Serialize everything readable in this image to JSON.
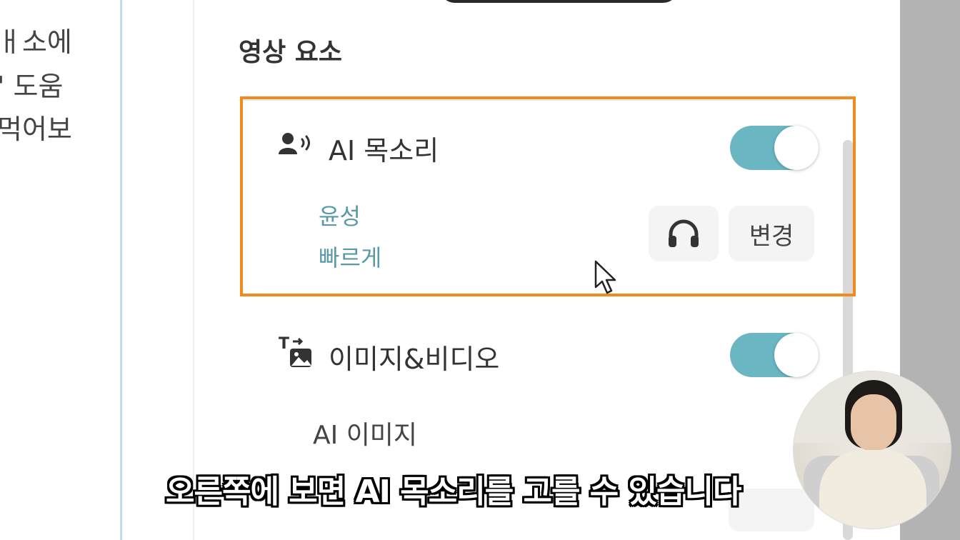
{
  "left_fragments": [
    "ㅐ소에",
    "' 도움",
    "먹어보"
  ],
  "section": {
    "title": "영상 요소"
  },
  "ai_voice": {
    "title": "AI 목소리",
    "icon": "voice-person-icon",
    "toggle_on": true,
    "voice_name": "윤성",
    "voice_speed": "빠르게",
    "listen_icon": "headphones-icon",
    "change_label": "변경"
  },
  "image_video": {
    "title": "이미지&비디오",
    "icon": "text-to-image-icon",
    "toggle_on": true,
    "sub_label": "AI 이미지"
  },
  "caption": {
    "text": "오른쪽에 보면 AI 목소리를 고를 수 있습니다"
  },
  "colors": {
    "accent": "#6bb6c3",
    "highlight": "#f28a1e",
    "link_text": "#5a9aa8"
  }
}
